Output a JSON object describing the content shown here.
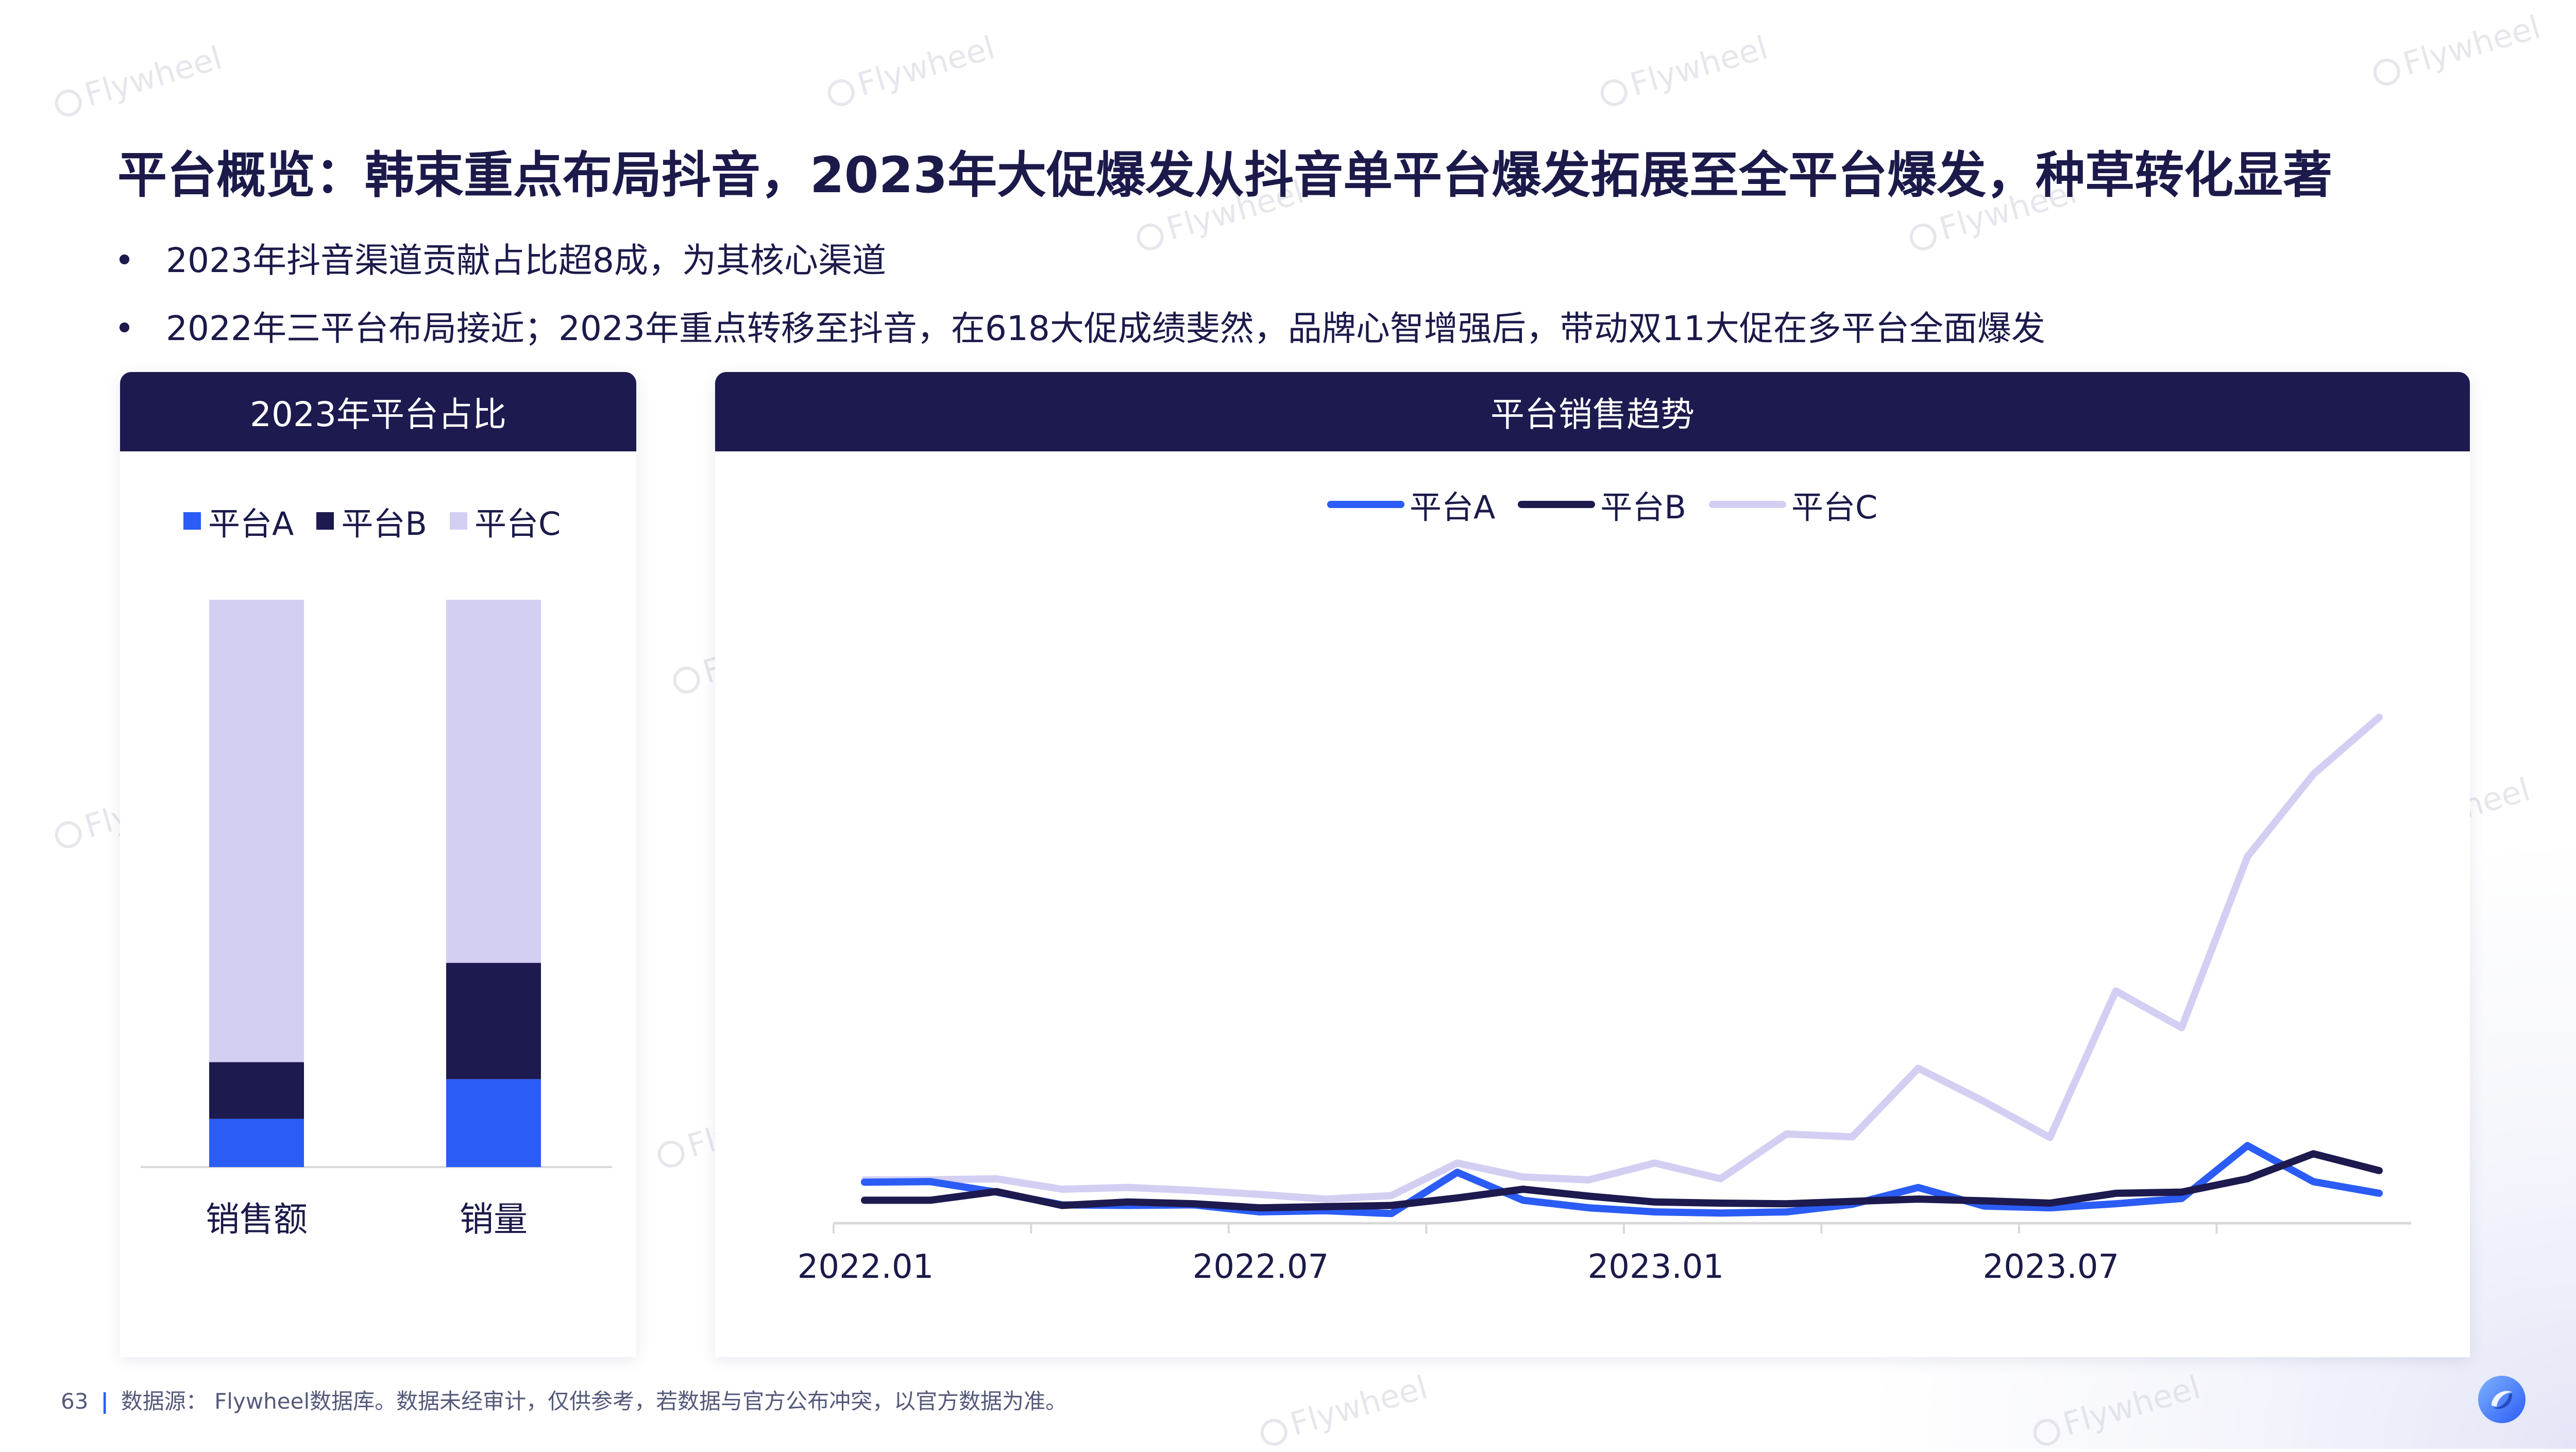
{
  "title": "平台概览：韩束重点布局抖音，2023年大促爆发从抖音单平台爆发拓展至全平台爆发，种草转化显著",
  "bullets": [
    "2023年抖音渠道贡献占比超8成，为其核心渠道",
    "2022年三平台布局接近；2023年重点转移至抖音，在618大促成绩斐然，品牌心智增强后，带动双11大促在多平台全面爆发"
  ],
  "colors": {
    "platform_a": "#2b5cf5",
    "platform_b": "#1c1a4e",
    "platform_c": "#d3cff3"
  },
  "left_chart": {
    "title": "2023年平台占比",
    "legend": [
      "平台A",
      "平台B",
      "平台C"
    ],
    "categories": [
      "销售额",
      "销量"
    ]
  },
  "right_chart": {
    "title": "平台销售趋势",
    "legend": [
      "平台A",
      "平台B",
      "平台C"
    ],
    "xticks": [
      "2022.01",
      "2022.07",
      "2023.01",
      "2023.07"
    ]
  },
  "chart_data": [
    {
      "type": "bar",
      "stacked": true,
      "title": "2023年平台占比",
      "categories": [
        "销售额",
        "销量"
      ],
      "series": [
        {
          "name": "平台A",
          "values": [
            8.5,
            15.5
          ]
        },
        {
          "name": "平台B",
          "values": [
            10,
            20.5
          ]
        },
        {
          "name": "平台C",
          "values": [
            81.5,
            64
          ]
        }
      ],
      "ylim": [
        0,
        100
      ],
      "legend_position": "top"
    },
    {
      "type": "line",
      "title": "平台销售趋势",
      "x": [
        "2022.01",
        "2022.02",
        "2022.03",
        "2022.04",
        "2022.05",
        "2022.06",
        "2022.07",
        "2022.08",
        "2022.09",
        "2022.10",
        "2022.11",
        "2022.12",
        "2023.01",
        "2023.02",
        "2023.03",
        "2023.04",
        "2023.05",
        "2023.06",
        "2023.07",
        "2023.08",
        "2023.09",
        "2023.10",
        "2023.11",
        "2023.12"
      ],
      "xticks": [
        "2022.01",
        "2022.07",
        "2023.01",
        "2023.07"
      ],
      "series": [
        {
          "name": "平台A",
          "values": [
            6.7,
            6.8,
            5.0,
            2.8,
            2.7,
            2.8,
            1.6,
            1.8,
            1.3,
            8.4,
            3.6,
            2.3,
            1.6,
            1.4,
            1.6,
            2.9,
            5.8,
            2.6,
            2.3,
            3.0,
            3.9,
            13.0,
            6.8,
            4.8
          ]
        },
        {
          "name": "平台B",
          "values": [
            3.6,
            3.6,
            5.1,
            2.7,
            3.3,
            3.0,
            2.3,
            2.5,
            2.7,
            4.0,
            5.5,
            4.3,
            3.3,
            3.1,
            3.0,
            3.4,
            3.8,
            3.5,
            3.1,
            4.8,
            5.0,
            7.3,
            11.6,
            8.7
          ]
        },
        {
          "name": "平台C",
          "values": [
            7.1,
            7.1,
            7.3,
            5.5,
            5.8,
            5.3,
            4.6,
            3.8,
            4.4,
            10.0,
            7.6,
            7.1,
            10.0,
            7.3,
            15.0,
            14.5,
            26.3,
            20.6,
            14.4,
            39.6,
            33.3,
            62.7,
            76.9,
            86.7
          ]
        }
      ],
      "ylim": [
        0,
        100
      ],
      "legend_position": "top"
    }
  ]
}
